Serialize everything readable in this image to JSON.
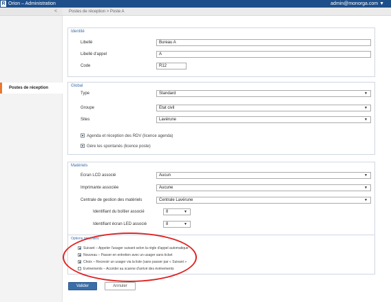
{
  "app": {
    "logo": "R",
    "title": "Orion – Administration",
    "user": "admin@monorga.com ▼"
  },
  "sidebar": {
    "collapse": "<",
    "items": [
      {
        "label": "Postes de réception"
      }
    ]
  },
  "breadcrumb": "Postes de réception > Poste A",
  "identite": {
    "title": "Identité",
    "libelle": {
      "label": "Libellé",
      "value": "Bureau A"
    },
    "libelle_appel": {
      "label": "Libellé d'appel",
      "value": "A"
    },
    "code": {
      "label": "Code",
      "value": "R12"
    }
  },
  "global": {
    "title": "Global",
    "type": {
      "label": "Type",
      "value": "Standard"
    },
    "groupe": {
      "label": "Groupe",
      "value": "Etat civil"
    },
    "sites": {
      "label": "Sites",
      "value": "Lavérune"
    },
    "checks": [
      {
        "label": "Agenda et réception des RDV (licence agenda)",
        "checked": true
      },
      {
        "label": "Gère les spontanés (licence poste)",
        "checked": true
      }
    ]
  },
  "materiels": {
    "title": "Matériels",
    "ecran": {
      "label": "Ecran LCD associé",
      "value": "Aucun"
    },
    "imprimante": {
      "label": "Imprimante associée",
      "value": "Aucune"
    },
    "centrale": {
      "label": "Centrale de gestion des matériels",
      "value": "Centrale Lavérune"
    },
    "boitier": {
      "label": "Identifiant du boîtier associé",
      "value": "8"
    },
    "ecran_led": {
      "label": "Identifiant écran LED associé",
      "value": "8"
    }
  },
  "options": {
    "title": "Options générales",
    "items": [
      {
        "label": "Suivant – Appeler l'usager suivant selon la règle d'appel automatique",
        "checked": true
      },
      {
        "label": "Nouveau – Passer en entretien avec un usager sans ticket",
        "checked": true
      },
      {
        "label": "Choix – Recevoir un usager via la liste (sans passer par « Suivant »",
        "checked": true
      },
      {
        "label": "Evénements – Accéder au scanne d'arrivé des événements",
        "checked": false
      }
    ]
  },
  "actions": {
    "save": "Valider",
    "cancel": "Annuler"
  },
  "colors": {
    "header": "#1f4f8a",
    "accent": "#e8772e",
    "panel_title": "#3a6ea8",
    "annotation": "#e02424"
  }
}
